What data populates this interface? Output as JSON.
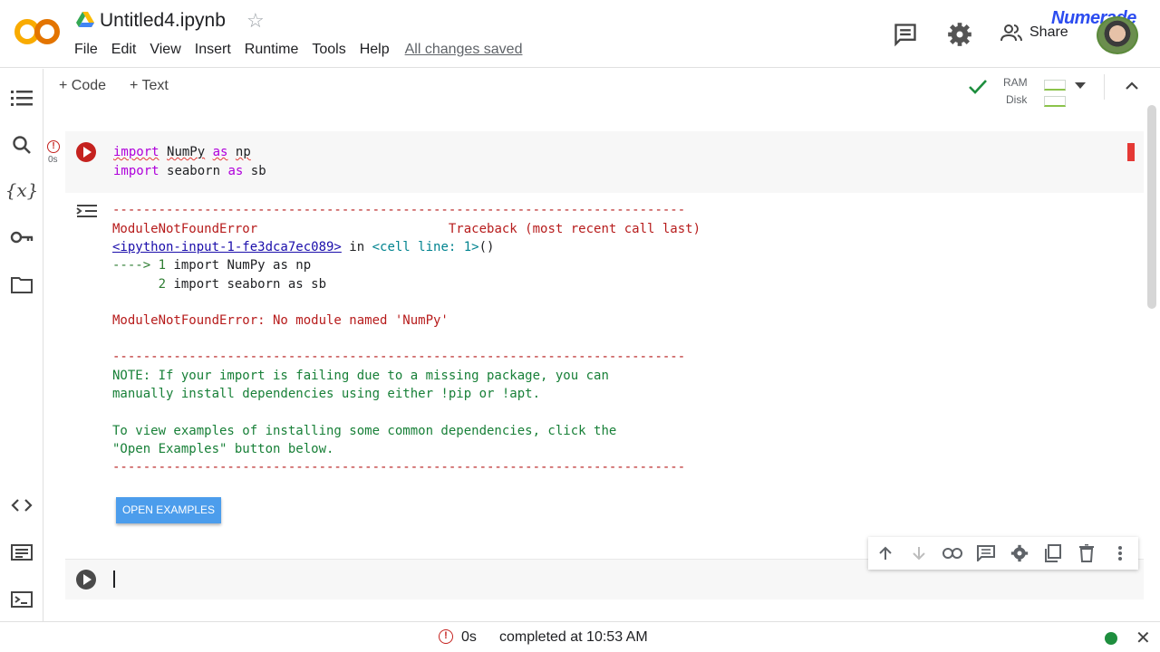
{
  "header": {
    "title": "Untitled4.ipynb",
    "menu": [
      "File",
      "Edit",
      "View",
      "Insert",
      "Runtime",
      "Tools",
      "Help"
    ],
    "save_status": "All changes saved",
    "share_label": "Share",
    "watermark": "Numerade"
  },
  "toolbar": {
    "add_code": "+ Code",
    "add_text": "+ Text",
    "ram_label": "RAM",
    "disk_label": "Disk"
  },
  "cell1": {
    "duration": "0s",
    "line1": {
      "kw1": "import",
      "mod": "NumPy",
      "kw2": "as",
      "alias": "np"
    },
    "line2": {
      "kw1": "import",
      "mod": "seaborn",
      "kw2": "as",
      "alias": "sb"
    }
  },
  "output": {
    "separator": "---------------------------------------------------------------------------",
    "error_name": "ModuleNotFoundError",
    "traceback_header": "Traceback (most recent call last)",
    "input_link": "<ipython-input-1-fe3dca7ec089>",
    "in_text": " in ",
    "cell_line": "<cell line: 1>",
    "call": "()",
    "arrow": "----> 1 ",
    "tb_line1": "import NumPy as np",
    "tb_indent2": "      2 ",
    "tb_line2": "import seaborn as sb",
    "error_message": "ModuleNotFoundError: No module named 'NumPy'",
    "note1": "NOTE: If your import is failing due to a missing package, you can",
    "note2": "manually install dependencies using either !pip or !apt.",
    "note3": "To view examples of installing some common dependencies, click the",
    "note4": "\"Open Examples\" button below.",
    "open_examples_label": "OPEN EXAMPLES"
  },
  "statusbar": {
    "duration": "0s",
    "completed": "completed at 10:53 AM",
    "runtime_status_color": "#1e8e3e"
  }
}
